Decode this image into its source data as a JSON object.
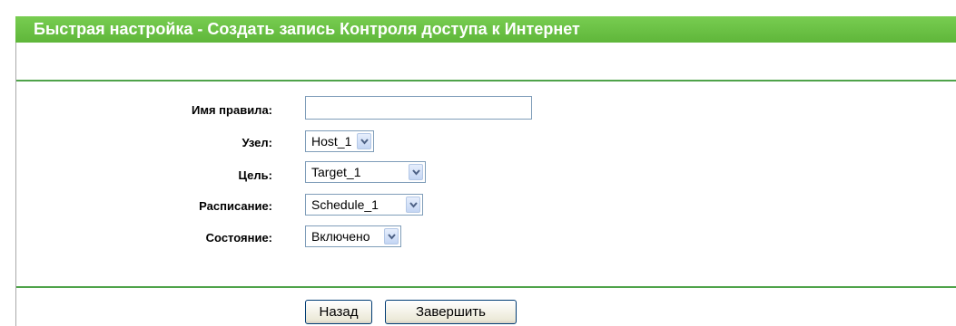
{
  "header": {
    "title": "Быстрая настройка - Создать запись Контроля доступа к Интернет"
  },
  "form": {
    "rule_name": {
      "label": "Имя правила:",
      "value": ""
    },
    "host": {
      "label": "Узел:",
      "value": "Host_1"
    },
    "target": {
      "label": "Цель:",
      "value": "Target_1"
    },
    "schedule": {
      "label": "Расписание:",
      "value": "Schedule_1"
    },
    "status": {
      "label": "Состояние:",
      "value": "Включено"
    }
  },
  "buttons": {
    "back": "Назад",
    "finish": "Завершить"
  },
  "colors": {
    "title_bar": "#6cc644",
    "divider": "#4fa34a"
  },
  "icons": {
    "dropdown": "chevron-down-icon"
  }
}
